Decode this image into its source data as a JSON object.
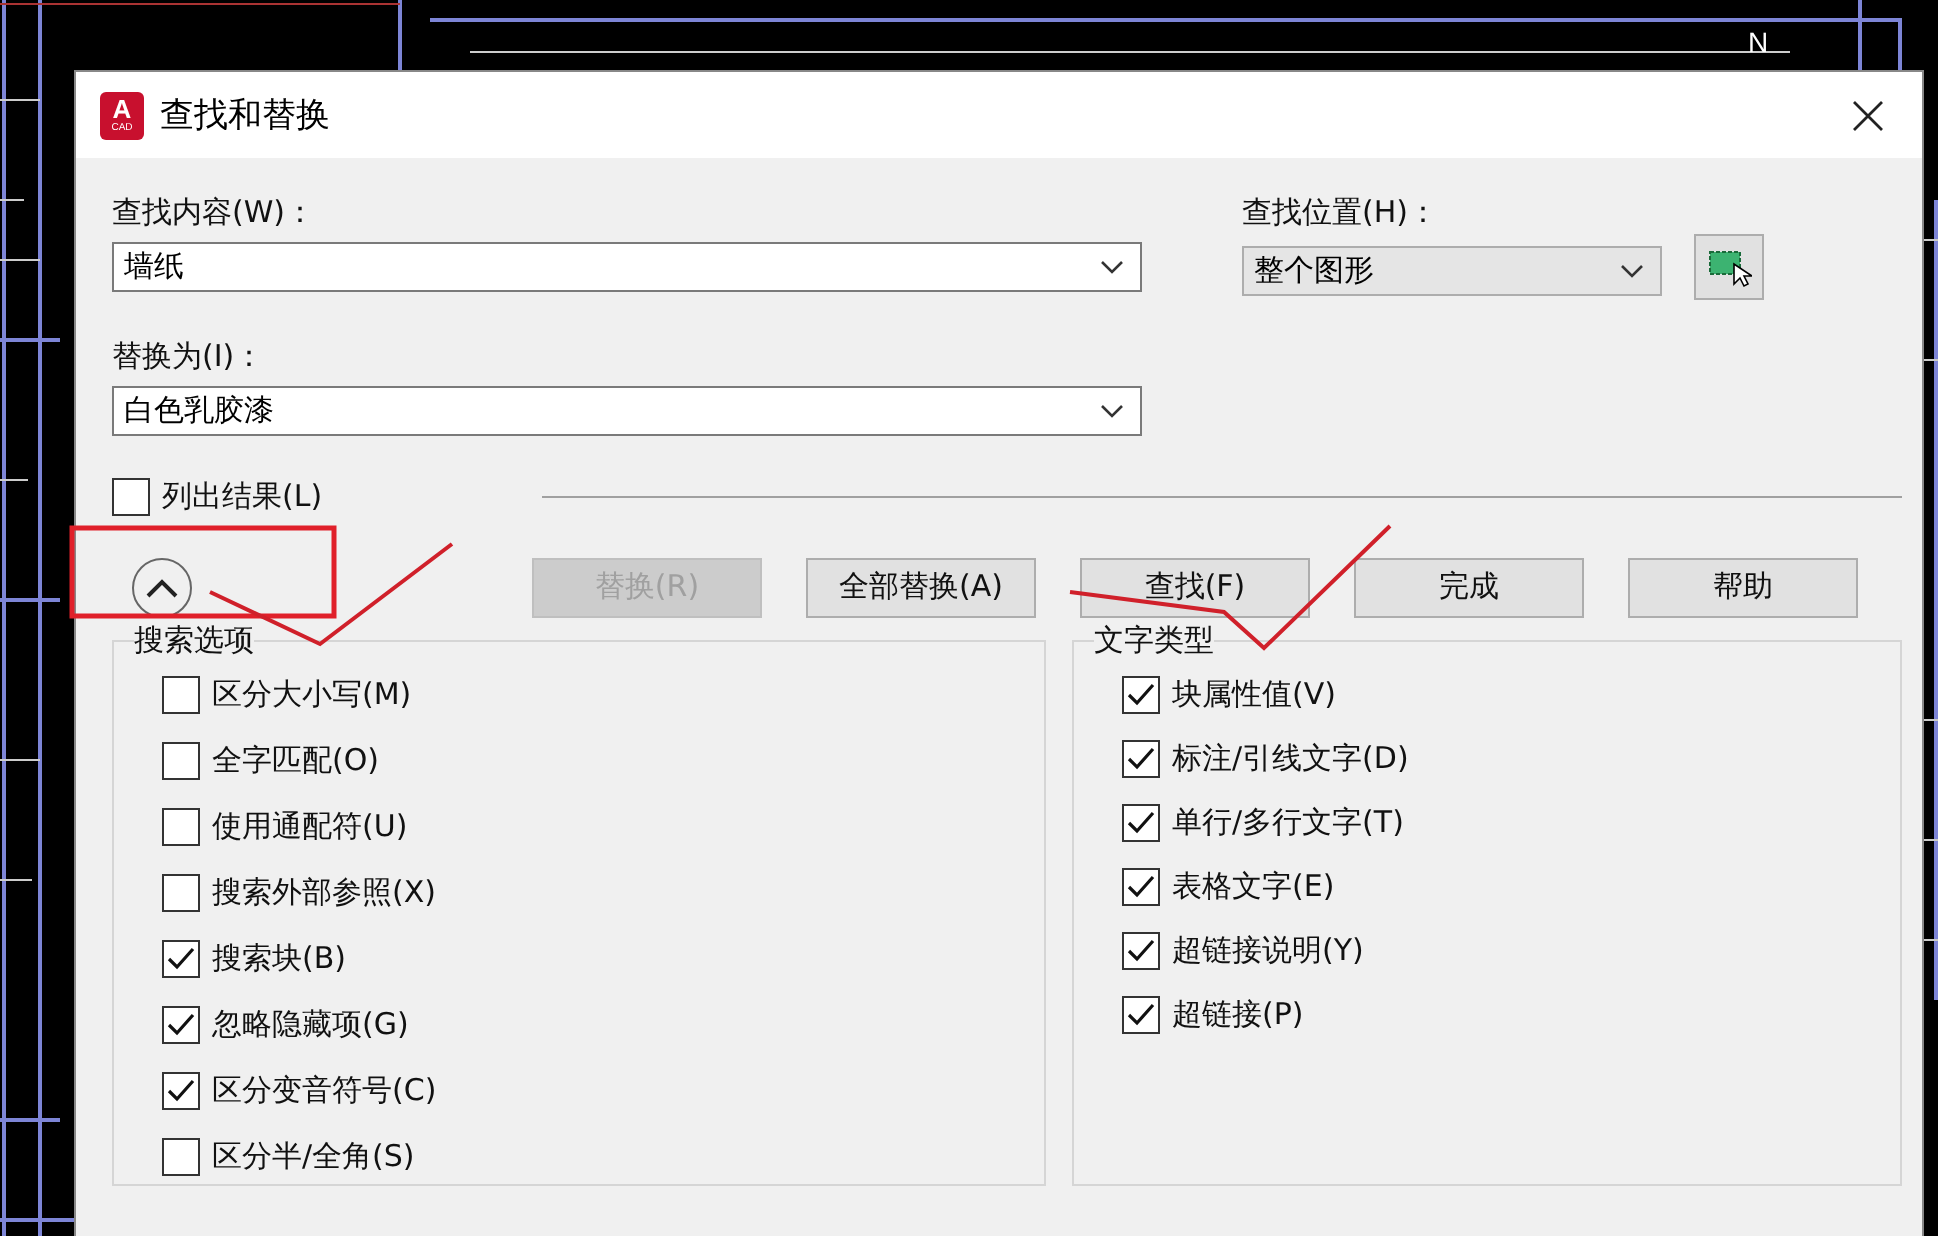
{
  "window": {
    "title": "查找和替换",
    "logo": {
      "letter": "A",
      "caption": "CAD"
    }
  },
  "canvas": {
    "north_label": "N"
  },
  "find_what": {
    "label": "查找内容(W)：",
    "value": "墙纸"
  },
  "find_where": {
    "label": "查找位置(H)：",
    "value": "整个图形"
  },
  "replace_with": {
    "label": "替换为(I)：",
    "value": "白色乳胶漆"
  },
  "list_results": {
    "label": "列出结果(L)",
    "checked": false
  },
  "options_toggle": {
    "expanded": true
  },
  "buttons": [
    {
      "label": "替换(R)",
      "disabled": true
    },
    {
      "label": "全部替换(A)",
      "disabled": false
    },
    {
      "label": "查找(F)",
      "disabled": false
    },
    {
      "label": "完成",
      "disabled": false
    },
    {
      "label": "帮助",
      "disabled": false
    }
  ],
  "search_options": {
    "title": "搜索选项",
    "items": [
      {
        "label": "区分大小写(M)",
        "checked": false
      },
      {
        "label": "全字匹配(O)",
        "checked": false
      },
      {
        "label": "使用通配符(U)",
        "checked": false
      },
      {
        "label": "搜索外部参照(X)",
        "checked": false
      },
      {
        "label": "搜索块(B)",
        "checked": true
      },
      {
        "label": "忽略隐藏项(G)",
        "checked": true
      },
      {
        "label": "区分变音符号(C)",
        "checked": true
      },
      {
        "label": "区分半/全角(S)",
        "checked": false
      }
    ]
  },
  "text_types": {
    "title": "文字类型",
    "items": [
      {
        "label": "块属性值(V)",
        "checked": true
      },
      {
        "label": "标注/引线文字(D)",
        "checked": true
      },
      {
        "label": "单行/多行文字(T)",
        "checked": true
      },
      {
        "label": "表格文字(E)",
        "checked": true
      },
      {
        "label": "超链接说明(Y)",
        "checked": true
      },
      {
        "label": "超链接(P)",
        "checked": true
      }
    ]
  }
}
